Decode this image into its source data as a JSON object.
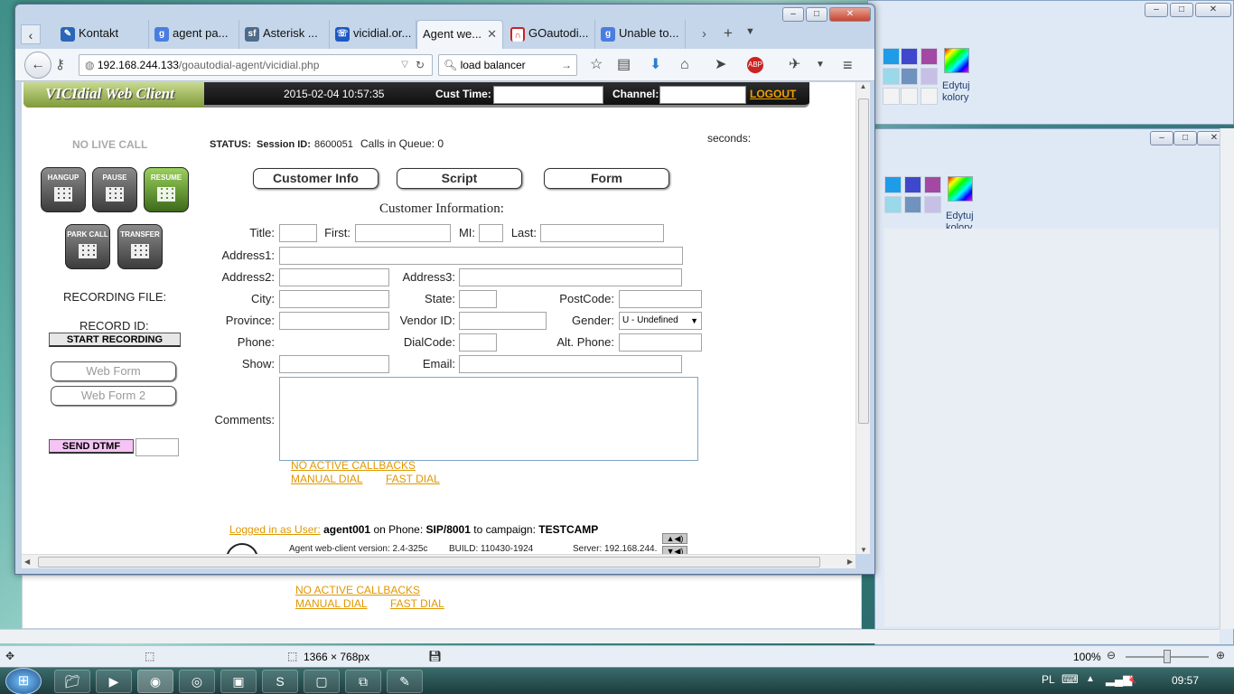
{
  "firefox": {
    "tabs": [
      {
        "label": "Kontakt",
        "icon": "kontakt-icon"
      },
      {
        "label": "agent pa...",
        "icon": "google-icon"
      },
      {
        "label": "Asterisk ...",
        "icon": "sf-icon"
      },
      {
        "label": "vicidial.or...",
        "icon": "phone-icon"
      },
      {
        "label": "Agent we...",
        "icon": "page-icon"
      },
      {
        "label": "GOautodi...",
        "icon": "goautodial-icon"
      },
      {
        "label": "Unable to...",
        "icon": "google-icon"
      }
    ],
    "url_host": "192.168.244.133",
    "url_path": "/goautodial-agent/vicidial.php",
    "search_value": "load balancer"
  },
  "vicidial": {
    "logo": "VICIdial Web Client",
    "datetime": "2015-02-04 10:57:35",
    "cust_time_label": "Cust Time:",
    "channel_label": "Channel:",
    "logout": "LOGOUT",
    "no_live_call": "NO LIVE CALL",
    "status_label": "STATUS:",
    "session_label": "Session ID:",
    "session_id": "8600051",
    "calls_in_queue": "Calls in Queue: 0",
    "seconds": "seconds:",
    "buttons": {
      "hangup": "HANGUP",
      "pause": "PAUSE",
      "resume": "RESUME",
      "park": "PARK CALL",
      "transfer": "TRANSFER"
    },
    "tabs": {
      "customer_info": "Customer Info",
      "script": "Script",
      "form": "Form"
    },
    "customer_info_title": "Customer Information:",
    "fields": {
      "title": "Title:",
      "first": "First:",
      "mi": "MI:",
      "last": "Last:",
      "address1": "Address1:",
      "address2": "Address2:",
      "address3": "Address3:",
      "city": "City:",
      "state": "State:",
      "postcode": "PostCode:",
      "province": "Province:",
      "vendor_id": "Vendor ID:",
      "gender": "Gender:",
      "phone": "Phone:",
      "dialcode": "DialCode:",
      "alt_phone": "Alt. Phone:",
      "show": "Show:",
      "email": "Email:",
      "comments": "Comments:"
    },
    "gender_value": "U - Undefined",
    "recording_file": "RECORDING FILE:",
    "record_id": "RECORD ID:",
    "start_recording": "START RECORDING",
    "web_form": "Web Form",
    "web_form_2": "Web Form 2",
    "send_dtmf": "SEND DTMF",
    "no_active_callbacks": "NO ACTIVE CALLBACKS",
    "manual_dial": "MANUAL DIAL",
    "fast_dial": "FAST DIAL",
    "logged_in_as": "Logged in as User:",
    "agent": "agent001",
    "on_phone": "on Phone:",
    "phone": "SIP/8001",
    "to_campaign": "to campaign:",
    "campaign": "TESTCAMP",
    "version": "Agent web-client version: 2.4-325c",
    "build": "BUILD: 110430-1924",
    "server": "Server: 192.168.244."
  },
  "paint": {
    "edit_colors": "Edytuj kolory"
  },
  "status_bar": {
    "size": "1366 × 768px",
    "zoom": "100%"
  },
  "taskbar": {
    "lang": "PL",
    "clock": "09:57"
  }
}
